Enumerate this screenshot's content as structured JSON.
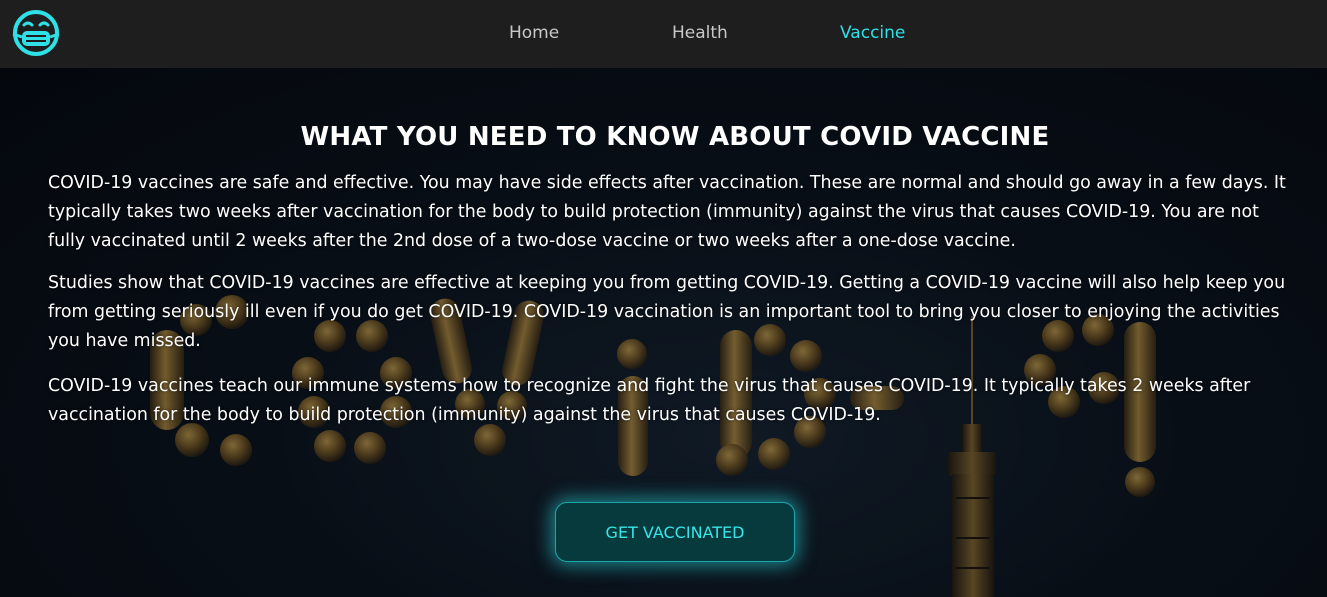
{
  "nav": {
    "logo_icon": "face-mask-icon",
    "links": [
      {
        "label": "Home",
        "active": false
      },
      {
        "label": "Health",
        "active": false
      },
      {
        "label": "Vaccine",
        "active": true
      }
    ]
  },
  "main": {
    "title": "WHAT YOU NEED TO KNOW ABOUT COVID VACCINE",
    "paragraphs": [
      "COVID-19 vaccines are safe and effective. You may have side effects after vaccination. These are normal and should go away in a few days. It typically takes two weeks after vaccination for the body to build protection (immunity) against the virus that causes COVID-19. You are not fully vaccinated until 2 weeks after the 2nd dose of a two-dose vaccine or two weeks after a one-dose vaccine.",
      "Studies show that COVID-19 vaccines are effective at keeping you from getting COVID-19. Getting a COVID-19 vaccine will also help keep you from getting seriously ill even if you do get COVID-19. COVID-19 vaccination is an important tool to bring you closer to enjoying the activities you have missed.",
      "COVID-19 vaccines teach our immune systems how to recognize and fight the virus that causes COVID-19. It typically takes 2 weeks after vaccination for the body to build protection (immunity) against the virus that causes COVID-19."
    ],
    "cta_label": "GET VACCINATED"
  },
  "colors": {
    "accent": "#2fe0e6",
    "navbar_bg": "#1e1e1e",
    "page_bg": "#06090f",
    "button_bg": "#063a3c"
  }
}
